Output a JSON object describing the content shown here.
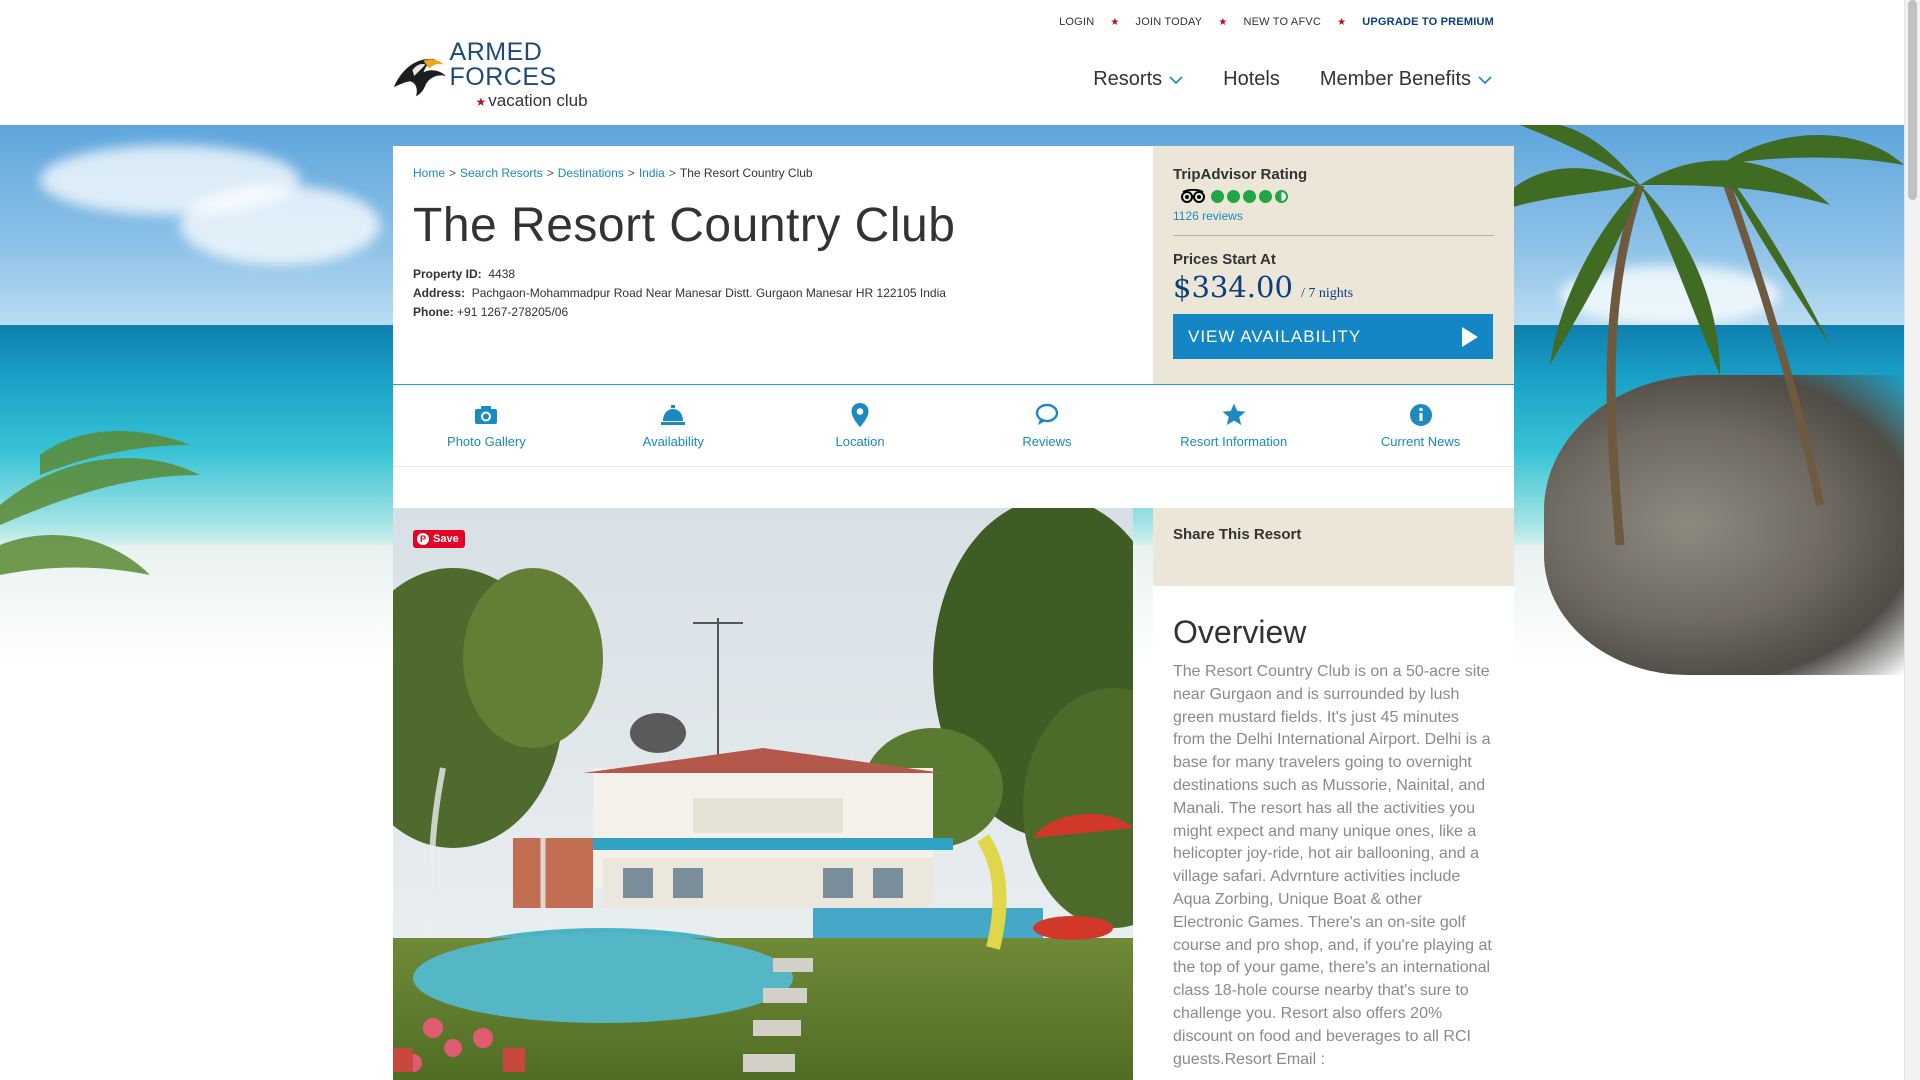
{
  "util_nav": {
    "login": "LOGIN",
    "join": "JOIN TODAY",
    "new": "NEW TO AFVC",
    "premium": "UPGRADE TO PREMIUM"
  },
  "logo": {
    "line1": "ARMED FORCES",
    "line2": "vacation club"
  },
  "main_nav": {
    "resorts": "Resorts",
    "hotels": "Hotels",
    "benefits": "Member Benefits"
  },
  "breadcrumb": [
    "Home",
    "Search Resorts",
    "Destinations",
    "India",
    "The Resort Country Club"
  ],
  "property": {
    "title": "The Resort Country Club",
    "id_label": "Property ID:",
    "id_value": "4438",
    "address_label": "Address:",
    "address_value": "Pachgaon-Mohammadpur Road Near Manesar Distt. Gurgaon Manesar HR 122105 India",
    "phone_label": "Phone:",
    "phone_value": "+91 1267-278205/06"
  },
  "tripadvisor": {
    "label": "TripAdvisor Rating",
    "rating": 4.5,
    "reviews": "1126 reviews",
    "color": "#22a545"
  },
  "pricing": {
    "label": "Prices Start At",
    "amount": "$334.00",
    "nights": "/ 7 nights",
    "button": "VIEW AVAILABILITY",
    "button_color": "#1486c6"
  },
  "tabs": [
    {
      "label": "Photo Gallery",
      "icon": "camera-icon"
    },
    {
      "label": "Availability",
      "icon": "service-bell-icon"
    },
    {
      "label": "Location",
      "icon": "map-pin-icon"
    },
    {
      "label": "Reviews",
      "icon": "chat-bubbles-icon"
    },
    {
      "label": "Resort Information",
      "icon": "star-icon"
    },
    {
      "label": "Current News",
      "icon": "info-icon"
    }
  ],
  "save_button": "Save",
  "share": {
    "title": "Share This Resort"
  },
  "overview": {
    "title": "Overview",
    "text": "The Resort Country Club is on a 50-acre site near Gurgaon and is surrounded by lush green mustard fields. It's just 45 minutes from the Delhi International Airport. Delhi is a base for many travelers going to overnight destinations such as Mussorie, Nainital, and Manali. The resort has all the activities you might expect and many unique ones, like a helicopter joy-ride, hot air ballooning, and a village safari. Advrnture activities include Aqua Zorbing, Unique Boat & other Electronic Games. There's an on-site golf course and pro shop, and, if you're playing at the top of your game, there's an international class 18-hole course nearby that's sure to challenge you. Resort also offers 20% discount on food and beverages to all RCI guests.Resort Email :"
  },
  "colors": {
    "link": "#1a8ac0",
    "brand_navy": "#0b3f7a",
    "panel_beige": "#ece6d9",
    "accent_red": "#b5121b"
  }
}
